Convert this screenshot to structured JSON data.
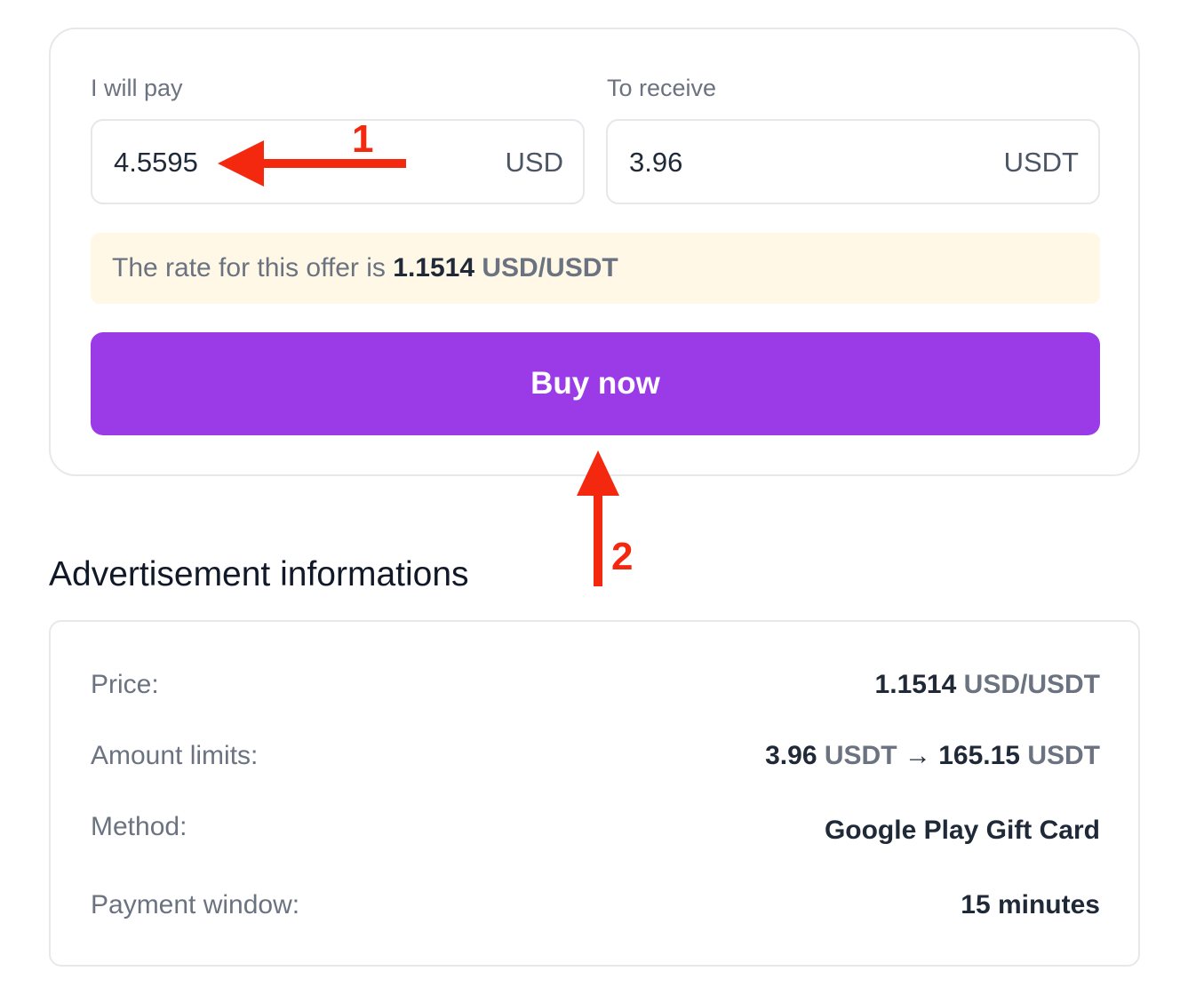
{
  "trade": {
    "pay_label": "I will pay",
    "pay_value": "4.5595",
    "pay_unit": "USD",
    "receive_label": "To receive",
    "receive_value": "3.96",
    "receive_unit": "USDT",
    "rate_prefix": "The rate for this offer is",
    "rate_value": "1.1514",
    "rate_unit": "USD/USDT",
    "buy_label": "Buy now"
  },
  "section_title": "Advertisement informations",
  "info": {
    "price_label": "Price:",
    "price_value": "1.1514",
    "price_unit": "USD/USDT",
    "limits_label": "Amount limits:",
    "limits_min": "3.96",
    "limits_min_unit": "USDT",
    "limits_arrow": "→",
    "limits_max": "165.15",
    "limits_max_unit": "USDT",
    "method_label": "Method:",
    "method_value": "Google Play Gift Card",
    "window_label": "Payment window:",
    "window_value": "15 minutes"
  },
  "annotations": {
    "marker_1": "1",
    "marker_2": "2",
    "color": "#f3280f"
  },
  "colors": {
    "accent": "#9b3be8",
    "rate_banner": "#fff8e6"
  },
  "icons": {
    "arrow_1": "arrow-left-icon",
    "arrow_2": "arrow-up-icon"
  }
}
